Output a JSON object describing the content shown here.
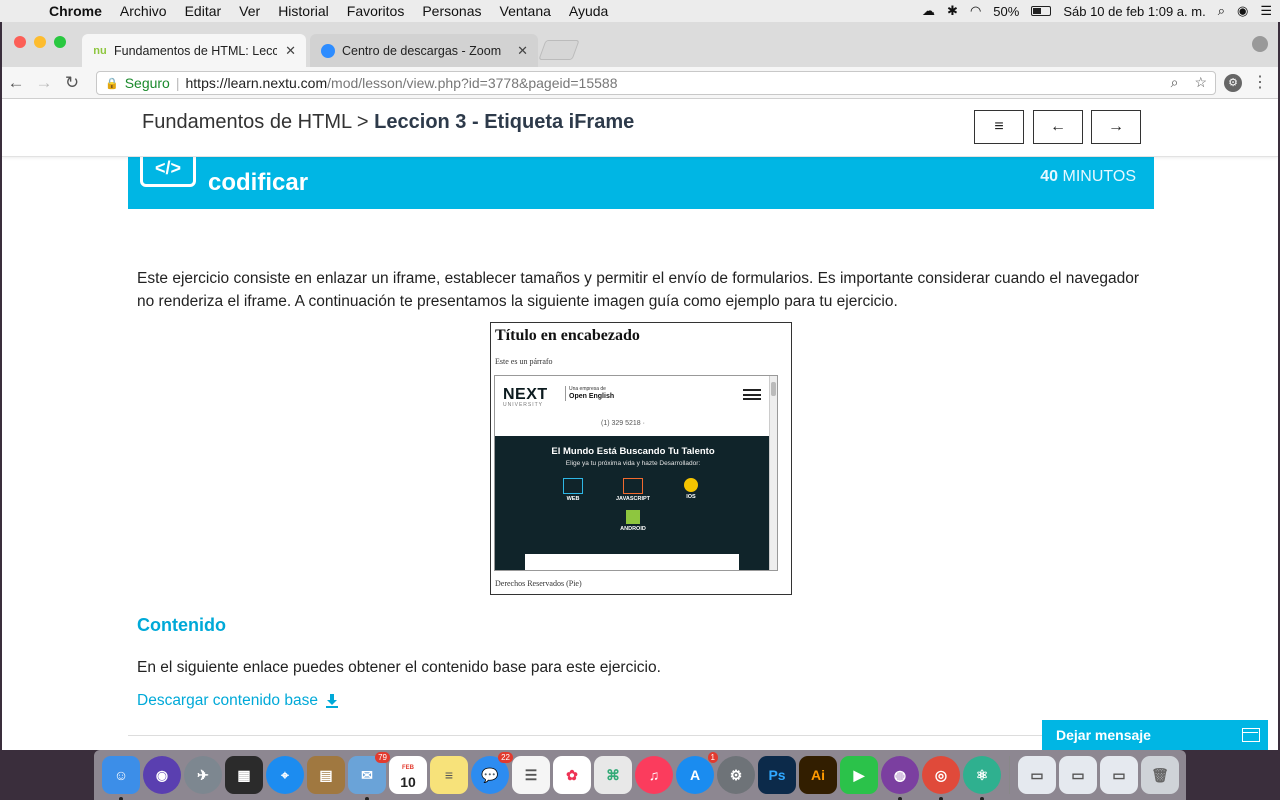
{
  "menubar": {
    "app": "Chrome",
    "items": [
      "Archivo",
      "Editar",
      "Ver",
      "Historial",
      "Favoritos",
      "Personas",
      "Ventana",
      "Ayuda"
    ],
    "battery": "50%",
    "datetime": "Sáb 10 de feb  1:09 a. m."
  },
  "tabs": [
    {
      "title": "Fundamentos de HTML: Leccio",
      "favicon": "nu"
    },
    {
      "title": "Centro de descargas - Zoom",
      "favicon": "zoom-icon"
    }
  ],
  "address_bar": {
    "secure_label": "Seguro",
    "url_host": "https://learn.nextu.com",
    "url_path": "/mod/lesson/view.php?id=3778&pageid=15588"
  },
  "lesson_header": {
    "course": "Fundamentos de HTML",
    "separator": ">",
    "lesson": "Leccion 3 - Etiqueta iFrame",
    "menu_icon": "≡",
    "prev_icon": "←",
    "next_icon": "→"
  },
  "banner": {
    "title": "codificar",
    "duration_number": "40",
    "duration_unit": "MINUTOS",
    "icon_text": "</>"
  },
  "intro_text": "Este ejercicio consiste en enlazar un iframe, establecer tamaños y permitir el envío de formularios. Es importante considerar cuando el navegador no renderiza el iframe. A continuación te presentamos la siguiente imagen guía como ejemplo para tu ejercicio.",
  "example_image": {
    "title": "Título en encabezado",
    "paragraph": "Este es un párrafo",
    "logo": "NEXT",
    "logo_sub": "UNIVERSITY",
    "oe_top": "Una empresa de",
    "oe_name": "Open English",
    "phone": "(1) 329 5218 ·",
    "hero_title": "El Mundo Está Buscando Tu Talento",
    "hero_sub": "Elige ya tu próxima vida y hazte Desarrollador:",
    "tracks": [
      "WEB",
      "JAVASCRIPT",
      "IOS",
      "ANDROID"
    ],
    "footer": "Derechos Reservados (Pie)"
  },
  "content_section": {
    "title": "Contenido",
    "text": "En el siguiente enlace puedes obtener el contenido base para este ejercicio.",
    "link": "Descargar contenido base"
  },
  "chat_widget": {
    "label": "Dejar mensaje"
  },
  "dock": {
    "badges": {
      "mail": "79",
      "calendar_day": "10",
      "calendar_month": "FEB",
      "messages": "22",
      "appstore": "1"
    }
  }
}
